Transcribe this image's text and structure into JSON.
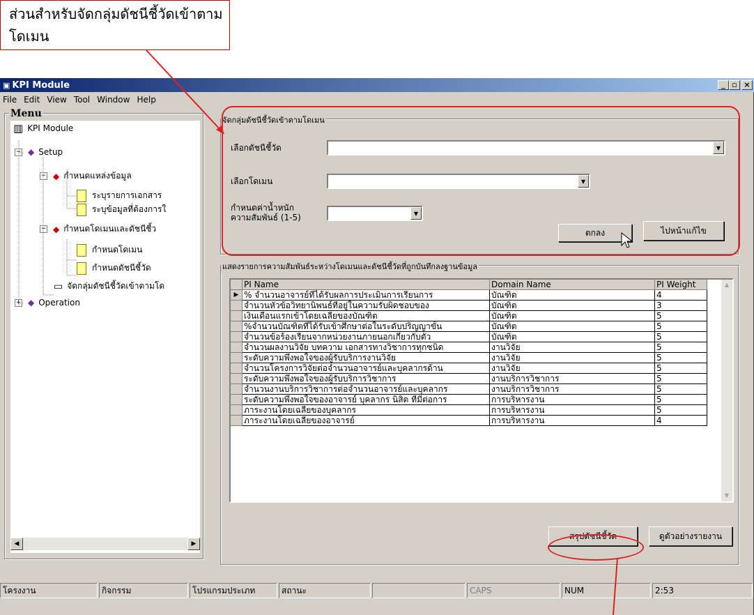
{
  "callout": {
    "text": "ส่วนสำหรับจัดกลุ่มดัชนีชี้วัดเข้าตามโดเมน"
  },
  "window": {
    "title": "KPI Module",
    "controls": {
      "minimize": "_",
      "restore": "▫",
      "close": "×"
    }
  },
  "menubar": [
    "File",
    "Edit",
    "View",
    "Tool",
    "Window",
    "Help"
  ],
  "sidebar": {
    "heading": "Menu",
    "root": "KPI Module",
    "nodes": {
      "setup": "Setup",
      "datasource": "กำหนดแหล่งข้อมูล",
      "doclist": "ระบุรายการเอกสาร",
      "datareq": "ระบุข้อมูลที่ต้องการใ",
      "domainpi": "กำหนดโดเมนและดัชนีชี้ว",
      "domain": "กำหนดโดเมน",
      "pi": "กำหนดดัชนีชี้วัด",
      "group": "จัดกลุ่มดัชนีชี้วัดเข้าตามโด",
      "operation": "Operation"
    }
  },
  "form": {
    "group_title": "จัดกลุ่มดัชนีชี้วัดเข้าตามโดเมน",
    "pi_label": "เลือกดัชนีชี้วัด",
    "domain_label": "เลือกโดเมน",
    "weight_label_1": "กำหนดค่าน้ำหนัก",
    "weight_label_2": "ความสัมพันธ์ (1-5)",
    "ok_button": "ตกลง",
    "edit_button": "ไปหน้าแก้ไข"
  },
  "table": {
    "group_title": "แสดงรายการความสัมพันธ์ระหว่างโดเมนและดัชนีชี้วัดที่ถูกบันทึกลงฐานข้อมูล",
    "columns": [
      "PI Name",
      "Domain Name",
      "PI Weight"
    ],
    "rows": [
      [
        "% จำนวนอาจารย์ที่ได้รับผลการประเมินการเรียนการ",
        "บัณฑิต",
        "4"
      ],
      [
        "จำนวนหัวข้อวิทยานิพนธ์ที่อยู่ในความรับผิดชอบของ",
        "บัณฑิต",
        "3"
      ],
      [
        "เงินเดือนแรกเข้าโดยเฉลี่ยของบัณฑิต",
        "บัณฑิต",
        "5"
      ],
      [
        "%จำนวนบัณฑิตที่ได้รับเข้าศึกษาต่อในระดับปริญญาขั้น",
        "บัณฑิต",
        "5"
      ],
      [
        "จำนวนข้อร้องเรียนจากหน่วยงานภายนอกเกี่ยวกับตัว",
        "บัณฑิต",
        "5"
      ],
      [
        "จำนวนผลงานวิจัย บทความ เอกสารทางวิชาการทุกชนิด",
        "งานวิจัย",
        "5"
      ],
      [
        "ระดับความพึงพอใจของผู้รับบริการงานวิจัย",
        "งานวิจัย",
        "5"
      ],
      [
        "จำนวนโครงการวิจัยต่อจำนวนอาจารย์และบุคลากรด้าน",
        "งานวิจัย",
        "5"
      ],
      [
        "ระดับความพึงพอใจของผู้รับบริการวิชาการ",
        "งานบริการวิชาการ",
        "5"
      ],
      [
        "จำนวนงานบริการวิชาการต่อจำนวนอาจารย์และบุคลากร",
        "งานบริการวิชาการ",
        "5"
      ],
      [
        "ระดับความพึงพอใจของอาจารย์ บุคลากร นิสิต ที่มีต่อการ",
        "การบริหารงาน",
        "5"
      ],
      [
        "ภาระงานโดยเฉลี่ยของบุคลากร",
        "การบริหารงาน",
        "5"
      ],
      [
        "ภาระงานโดยเฉลี่ยของอาจารย์",
        "การบริหารงาน",
        "4"
      ]
    ]
  },
  "bottom_buttons": {
    "summary": "สรุปดัชนีชี้วัด",
    "report": "ดูตัวอย่างรายงาน"
  },
  "statusbar": [
    "โครงงาน",
    "กิจกรรม",
    "โปรแกรมประเภท",
    "สถานะ",
    "",
    "CAPS",
    "NUM",
    "2:53"
  ],
  "colors": {
    "annotation": "#e02020",
    "title_gradient_start": "#0a246a",
    "title_gradient_end": "#a6caf0"
  }
}
